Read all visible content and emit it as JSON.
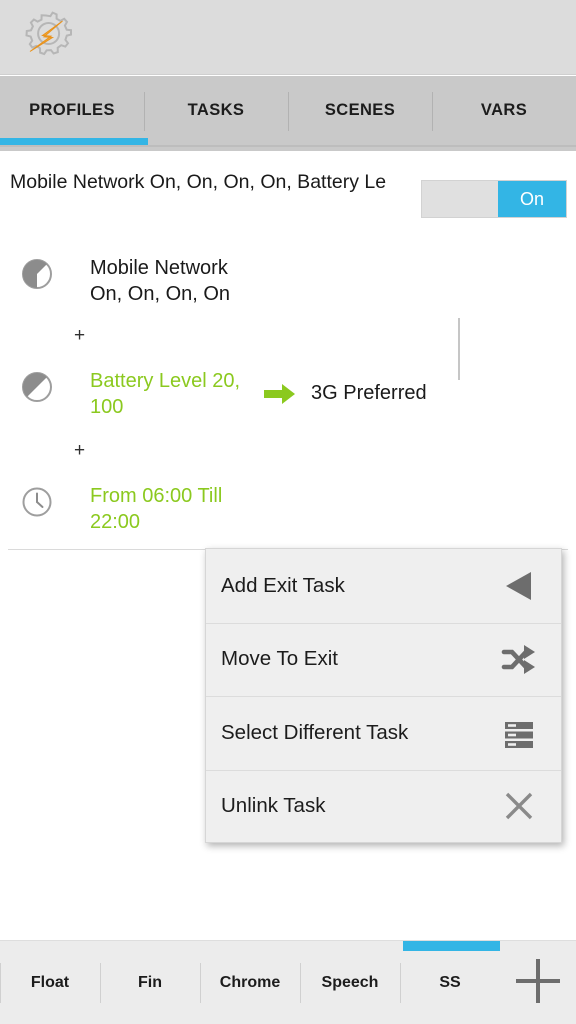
{
  "app": {
    "name": "Tasker",
    "logo_icon": "tasker-gear-bolt-logo"
  },
  "top_tabs": {
    "items": [
      {
        "label": "PROFILES",
        "selected": true
      },
      {
        "label": "TASKS",
        "selected": false
      },
      {
        "label": "SCENES",
        "selected": false
      },
      {
        "label": "VARS",
        "selected": false
      }
    ],
    "indicator_color": "#33b5e5"
  },
  "profile_header": {
    "title": "Mobile Network On, On, On, On, Battery Le",
    "toggle": {
      "state_label": "On",
      "on": true,
      "on_color": "#33b5e5",
      "track_color": "#e0e0e0"
    }
  },
  "profile": {
    "contexts": [
      {
        "icon": "state-circle-icon",
        "name": "Mobile Network",
        "detail": "On, On, On, On",
        "color": "#1a1a1a"
      },
      {
        "icon": "state-circle-icon",
        "name": "Battery Level 20,",
        "detail": "100",
        "color": "#8bc91f"
      },
      {
        "icon": "clock-icon",
        "name": "From 06:00 Till",
        "detail": "22:00",
        "color": "#8bc91f"
      }
    ],
    "joiner": "+",
    "task": {
      "arrow_icon": "green-right-arrow-icon",
      "name": "3G Preferred"
    }
  },
  "context_menu": {
    "items": [
      {
        "label": "Add Exit Task",
        "icon": "left-triangle-icon"
      },
      {
        "label": "Move To Exit",
        "icon": "shuffle-icon"
      },
      {
        "label": "Select Different Task",
        "icon": "list-rows-icon"
      },
      {
        "label": "Unlink Task",
        "icon": "close-x-icon"
      }
    ]
  },
  "bottom_tabs": {
    "items": [
      {
        "label": "Float",
        "selected": false
      },
      {
        "label": "Fin",
        "selected": false
      },
      {
        "label": "Chrome",
        "selected": false
      },
      {
        "label": "Speech",
        "selected": false
      },
      {
        "label": "SS",
        "selected": true
      }
    ],
    "add_button_icon": "plus-icon",
    "indicator_color": "#33b5e5"
  }
}
